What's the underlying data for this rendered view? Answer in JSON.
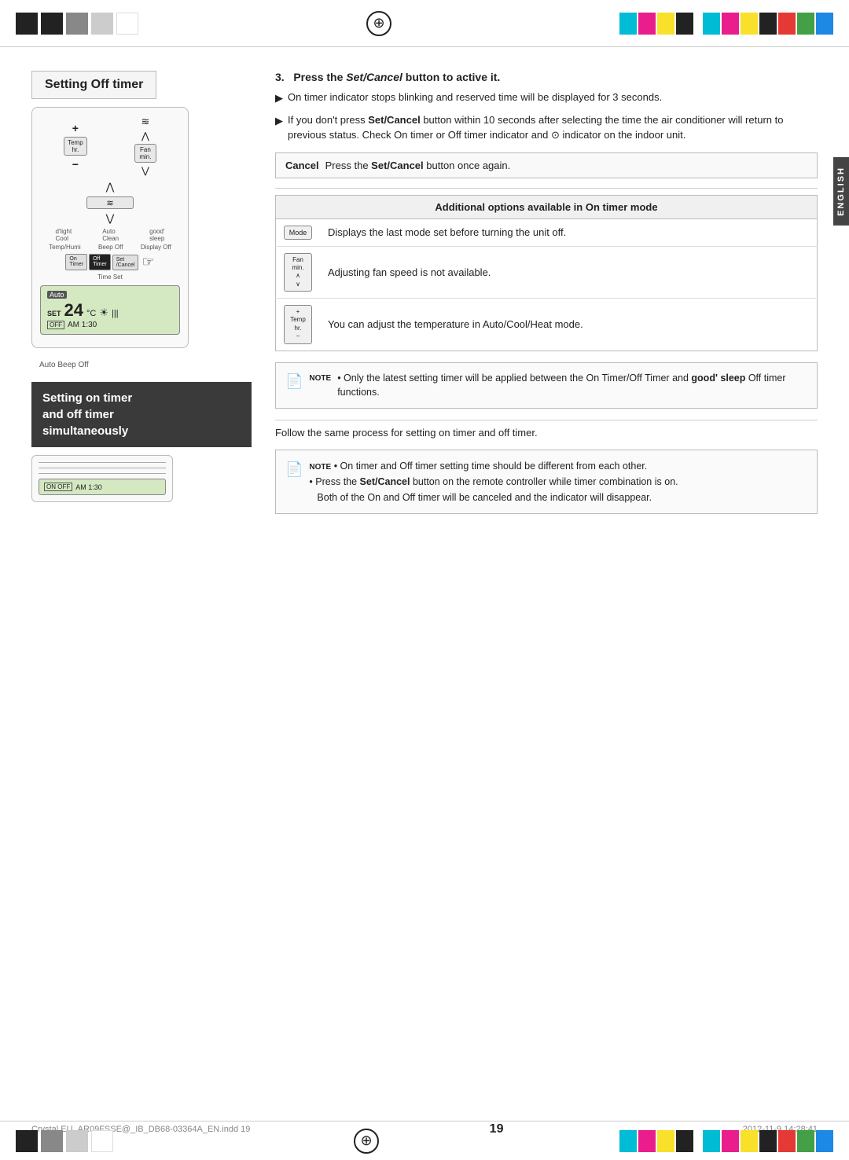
{
  "topBar": {
    "compassSymbol": "⊕"
  },
  "sections": {
    "settingOffTimer": {
      "title": "Setting Off timer",
      "step3Header": "3.   Press the Set/Cancel button to active it.",
      "step3HeaderBold": "Set/Cancel",
      "bullet1": "On timer indicator stops blinking and reserved time will be displayed for 3 seconds.",
      "bullet2Start": "If you don't press ",
      "bullet2Bold": "Set/Cancel",
      "bullet2End": " button within 10 seconds after selecting the time the air conditioner will return to previous status. Check On timer or Off timer indicator and",
      "bullet2End2": "indicator on the indoor unit.",
      "cancelLabel": "Cancel",
      "cancelText": "Press the Set/Cancel button once again.",
      "cancelBold": "Set/Cancel",
      "additionalOptionsHeader": "Additional options available in On timer mode",
      "tableRows": [
        {
          "iconLabel": "Mode",
          "description": "Displays the last mode set before turning the unit off."
        },
        {
          "iconLabel": "Fan min. ∧ ∨",
          "description": "Adjusting fan speed is not available."
        },
        {
          "iconLabel": "+ Temp hr. −",
          "description": "You can adjust the temperature in Auto/Cool/Heat mode."
        }
      ],
      "noteText": "Only the latest setting timer will be applied between the On Timer/Off Timer and ",
      "noteBold": "good' sleep",
      "noteTextEnd": "Off timer functions."
    },
    "settingOnOffSimultaneous": {
      "title": "Setting on timer\nand off timer\nsimultaneously",
      "followText": "Follow the same process for setting on timer and off timer.",
      "bottomNote1": "On timer and Off timer setting time should be different from each other.",
      "bottomNote2Start": "Press the ",
      "bottomNote2Bold": "Set/Cancel",
      "bottomNote2End": " button on the remote controller while timer combination is on.",
      "bottomNote3": "Both of the On and Off timer will be canceled and the indicator will disappear."
    }
  },
  "remote": {
    "autoLabel": "Auto",
    "setTemp": "SET 24°C",
    "offBadge": "OFF",
    "amTime": "AM 1:30",
    "beeOffLabel": "Beep Off",
    "buttons": {
      "temp": "Temp hr.",
      "fan": "Fan min.",
      "dlight": "d'light Cool",
      "auto": "Auto Clean",
      "good": "good' sleep",
      "tempHumi": "Temp/Humi",
      "beeOff": "Beep Off",
      "displayOff": "Display Off",
      "on": "On Timer",
      "off": "Off Timer",
      "set": "Set /Cancel"
    }
  },
  "miniRemote": {
    "onOffBadge": "ON OFF",
    "amTime": "AM 1:30"
  },
  "sidebar": {
    "english": "ENGLISH"
  },
  "footer": {
    "leftText": "Crystal  EU_AR09FSSE@_IB_DB68-03364A_EN.indd   19",
    "rightText": "2012-11-9   14:28:41",
    "pageNumber": "19"
  }
}
